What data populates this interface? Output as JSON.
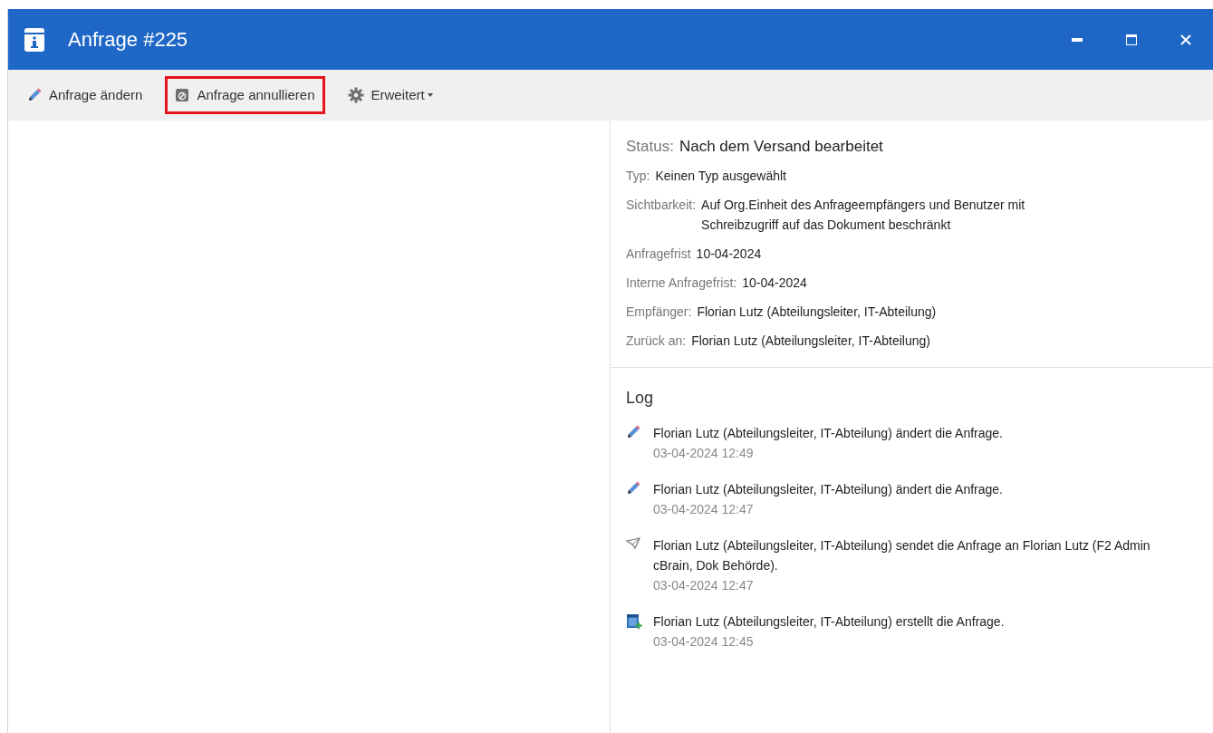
{
  "window": {
    "title": "Anfrage #225"
  },
  "toolbar": [
    {
      "kind": "edit",
      "label": "Anfrage ändern",
      "highlighted": false
    },
    {
      "kind": "cancel",
      "label": "Anfrage annullieren",
      "highlighted": true
    },
    {
      "kind": "settings",
      "label": "Erweitert",
      "dropdown": true,
      "highlighted": false
    }
  ],
  "details": {
    "status": {
      "label": "Status:",
      "value": "Nach dem Versand bearbeitet"
    },
    "fields": [
      {
        "label": "Typ:",
        "value": "Keinen Typ ausgewählt"
      },
      {
        "label": "Sichtbarkeit:",
        "value": "Auf Org.Einheit des Anfrageempfängers und Benutzer mit Schreibzugriff auf das Dokument beschränkt"
      },
      {
        "label": "Anfragefrist",
        "value": "10-04-2024"
      },
      {
        "label": "Interne Anfragefrist:",
        "value": "10-04-2024"
      },
      {
        "label": "Empfänger:",
        "value": "Florian Lutz (Abteilungsleiter, IT-Abteilung)"
      },
      {
        "label": "Zurück an:",
        "value": "Florian Lutz (Abteilungsleiter, IT-Abteilung)"
      }
    ]
  },
  "log": {
    "title": "Log",
    "entries": [
      {
        "kind": "edit",
        "text": "Florian Lutz (Abteilungsleiter, IT-Abteilung) ändert die Anfrage.",
        "time": "03-04-2024 12:49"
      },
      {
        "kind": "edit",
        "text": "Florian Lutz (Abteilungsleiter, IT-Abteilung) ändert die Anfrage.",
        "time": "03-04-2024 12:47"
      },
      {
        "kind": "send",
        "text": "Florian Lutz (Abteilungsleiter, IT-Abteilung) sendet die Anfrage an Florian Lutz (F2 Admin cBrain, Dok Behörde).",
        "time": "03-04-2024 12:47"
      },
      {
        "kind": "create",
        "text": "Florian Lutz (Abteilungsleiter, IT-Abteilung) erstellt die Anfrage.",
        "time": "03-04-2024 12:45"
      }
    ]
  }
}
